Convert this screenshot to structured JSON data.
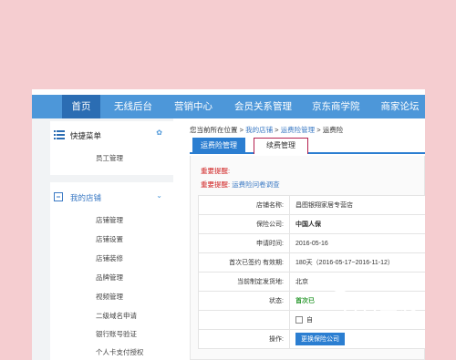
{
  "nav": {
    "items": [
      {
        "label": "首页",
        "active": true
      },
      {
        "label": "无线后台"
      },
      {
        "label": "营销中心"
      },
      {
        "label": "会员关系管理"
      },
      {
        "label": "京东商学院"
      },
      {
        "label": "商家论坛"
      }
    ]
  },
  "sidebar": {
    "quick_menu": {
      "title": "快捷菜单",
      "items": [
        "员工管理"
      ]
    },
    "my_shop": {
      "title": "我的店铺",
      "items": [
        "店铺管理",
        "店铺设置",
        "店铺装修",
        "品牌管理",
        "视频管理",
        "二级域名申请",
        "银行账号验证",
        "个人卡支付授权"
      ]
    }
  },
  "breadcrumb": {
    "prefix": "您当前所在位置",
    "sep": ">",
    "items": [
      "我的店铺",
      "运费险管理",
      "运费险"
    ]
  },
  "tabs": {
    "active": "运费险管理",
    "renew": "续费管理"
  },
  "notice": {
    "line1": "重要提醒:",
    "line2_prefix": "重要提醒:",
    "line2_link": "运费险问卷调查"
  },
  "info": {
    "rows": [
      {
        "k": "店铺名称:",
        "v": "昌图银翔家居专营店"
      },
      {
        "k": "保险公司:",
        "v": "中国人保"
      },
      {
        "k": "申请时间:",
        "v": "2016-05-16"
      },
      {
        "k": "首次已签约 有效期:",
        "v": "180天（2016-05-17~2016-11-12）"
      },
      {
        "k": "当前制定发货地:",
        "v": "北京"
      },
      {
        "k": "状态:",
        "v": "首次已"
      },
      {
        "k": "",
        "v": "自"
      },
      {
        "k": "操作:",
        "v": "更换保险公司"
      }
    ]
  },
  "watermark": {
    "title": "百科全说",
    "subtitle": "助你轻松解决"
  },
  "colors": {
    "nav": "#4d97d9",
    "nav_active": "#2b6db3",
    "tab_active": "#2b7ed1",
    "highlight_border": "#b51f4e",
    "notice_red": "#d12626",
    "status_green": "#2e9a32",
    "page_bg": "#f5cdd0"
  }
}
